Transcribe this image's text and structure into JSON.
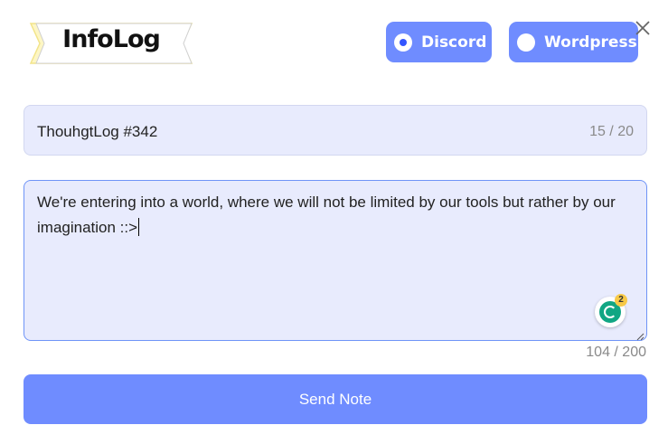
{
  "app": {
    "logo_text": "InfoLog"
  },
  "platforms": {
    "discord": {
      "label": "Discord",
      "selected": true
    },
    "wordpress": {
      "label": "Wordpress",
      "selected": false
    }
  },
  "title_field": {
    "value": "ThouhgtLog #342",
    "counter": "15 / 20"
  },
  "body_field": {
    "value": "We're entering into a world, where we will not be limited by our tools but rather by our imagination ::>",
    "counter": "104 / 200",
    "grammar_issue_count": "2"
  },
  "actions": {
    "send_label": "Send Note"
  },
  "colors": {
    "accent": "#6f8cff",
    "field_background": "#e8ebfd",
    "focus_border": "#6f94f7",
    "grammar_badge": "#11a683"
  },
  "icons": {
    "close": "close-icon",
    "radio_checked": "radio-checked-icon",
    "radio_unchecked": "radio-unchecked-icon",
    "grammar": "grammar-checker-icon",
    "resize": "resize-handle-icon"
  }
}
